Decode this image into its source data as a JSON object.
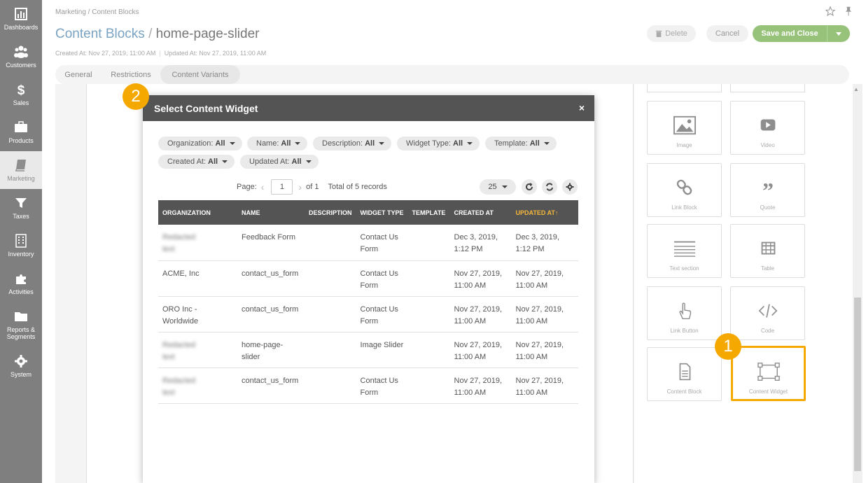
{
  "sidebar": {
    "items": [
      {
        "label": "Dashboards",
        "icon": "bar-chart-icon"
      },
      {
        "label": "Customers",
        "icon": "users-icon"
      },
      {
        "label": "Sales",
        "icon": "dollar-icon"
      },
      {
        "label": "Products",
        "icon": "briefcase-icon"
      },
      {
        "label": "Marketing",
        "icon": "book-icon",
        "active": true
      },
      {
        "label": "Taxes",
        "icon": "filter-icon"
      },
      {
        "label": "Inventory",
        "icon": "building-icon"
      },
      {
        "label": "Activities",
        "icon": "puzzle-icon"
      },
      {
        "label": "Reports &\nSegments",
        "icon": "folder-icon"
      },
      {
        "label": "System",
        "icon": "gear-icon"
      }
    ]
  },
  "header": {
    "breadcrumb": "Marketing / Content Blocks",
    "title_section": "Content Blocks",
    "title_separator": "/",
    "title_entity": "home-page-slider",
    "created_at": "Created At: Nov 27, 2019, 11:00 AM",
    "updated_at": "Updated At: Nov 27, 2019, 11:00 AM",
    "delete_label": "Delete",
    "cancel_label": "Cancel",
    "save_label": "Save and Close"
  },
  "tabs": [
    "General",
    "Restrictions",
    "Content Variants"
  ],
  "blocks": {
    "items": [
      {
        "label": "Image",
        "icon": "image-icon"
      },
      {
        "label": "Video",
        "icon": "video-icon"
      },
      {
        "label": "Link Block",
        "icon": "link-icon"
      },
      {
        "label": "Quote",
        "icon": "quote-icon"
      },
      {
        "label": "Text section",
        "icon": "text-lines-icon"
      },
      {
        "label": "Table",
        "icon": "table-icon"
      },
      {
        "label": "Link Button",
        "icon": "hand-pointer-icon"
      },
      {
        "label": "Code",
        "icon": "code-icon"
      },
      {
        "label": "Content Block",
        "icon": "document-icon"
      },
      {
        "label": "Content Widget",
        "icon": "widget-icon",
        "selected": true
      }
    ]
  },
  "badges": {
    "one": "1",
    "two": "2"
  },
  "modal": {
    "title": "Select Content Widget",
    "close_icon": "×",
    "filters": [
      {
        "name": "Organization:",
        "value": "All"
      },
      {
        "name": "Name:",
        "value": "All"
      },
      {
        "name": "Description:",
        "value": "All"
      },
      {
        "name": "Widget Type:",
        "value": "All"
      },
      {
        "name": "Template:",
        "value": "All"
      },
      {
        "name": "Created At:",
        "value": "All"
      },
      {
        "name": "Updated At:",
        "value": "All"
      }
    ],
    "pager": {
      "page_label": "Page:",
      "page": "1",
      "of_label": "of 1",
      "total_label": "Total of 5 records",
      "page_size": "25"
    },
    "columns": [
      "ORGANIZATION",
      "NAME",
      "DESCRIPTION",
      "WIDGET TYPE",
      "TEMPLATE",
      "CREATED AT",
      "UPDATED AT"
    ],
    "sort_indicator": "↑",
    "rows": [
      {
        "organization": "blurred",
        "name": "Feedback Form",
        "description": "",
        "widget_type": "Contact Us Form",
        "template": "",
        "created_at": "Dec 3, 2019, 1:12 PM",
        "updated_at": "Dec 3, 2019, 1:12 PM"
      },
      {
        "organization": "ACME, Inc",
        "name": "contact_us_form",
        "description": "",
        "widget_type": "Contact Us Form",
        "template": "",
        "created_at": "Nov 27, 2019, 11:00 AM",
        "updated_at": "Nov 27, 2019, 11:00 AM"
      },
      {
        "organization": "ORO Inc - Worldwide",
        "name": "contact_us_form",
        "description": "",
        "widget_type": "Contact Us Form",
        "template": "",
        "created_at": "Nov 27, 2019, 11:00 AM",
        "updated_at": "Nov 27, 2019, 11:00 AM"
      },
      {
        "organization": "blurred",
        "name": "home-page-slider",
        "description": "",
        "widget_type": "Image Slider",
        "template": "",
        "created_at": "Nov 27, 2019, 11:00 AM",
        "updated_at": "Nov 27, 2019, 11:00 AM"
      },
      {
        "organization": "blurred",
        "name": "contact_us_form",
        "description": "",
        "widget_type": "Contact Us Form",
        "template": "",
        "created_at": "Nov 27, 2019, 11:00 AM",
        "updated_at": "Nov 27, 2019, 11:00 AM"
      }
    ]
  },
  "colors": {
    "accent_orange": "#f5a800",
    "save_green": "#97c27a",
    "title_blue": "#7aa3c2",
    "header_dark": "#545454"
  }
}
